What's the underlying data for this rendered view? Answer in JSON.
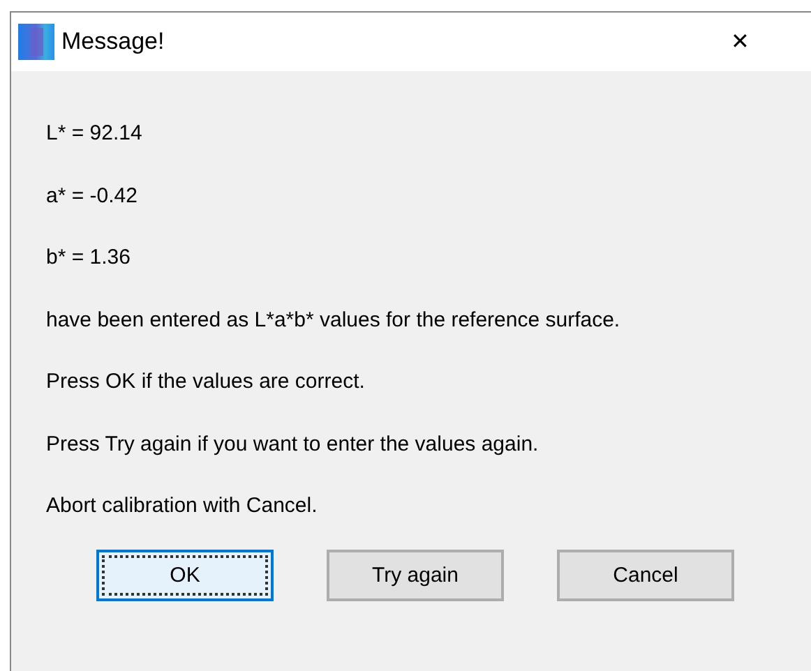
{
  "window": {
    "title": "Message!",
    "close": "✕"
  },
  "lines": [
    "L* = 92.14",
    "a* = -0.42",
    "b* = 1.36",
    "have been entered as L*a*b* values for the reference surface.",
    "Press OK if the values are correct.",
    "Press Try again if you want to enter the values again.",
    "Abort calibration with Cancel."
  ],
  "buttons": [
    {
      "label": "OK",
      "focused": true
    },
    {
      "label": "Try again",
      "focused": false
    },
    {
      "label": "Cancel",
      "focused": false
    }
  ]
}
